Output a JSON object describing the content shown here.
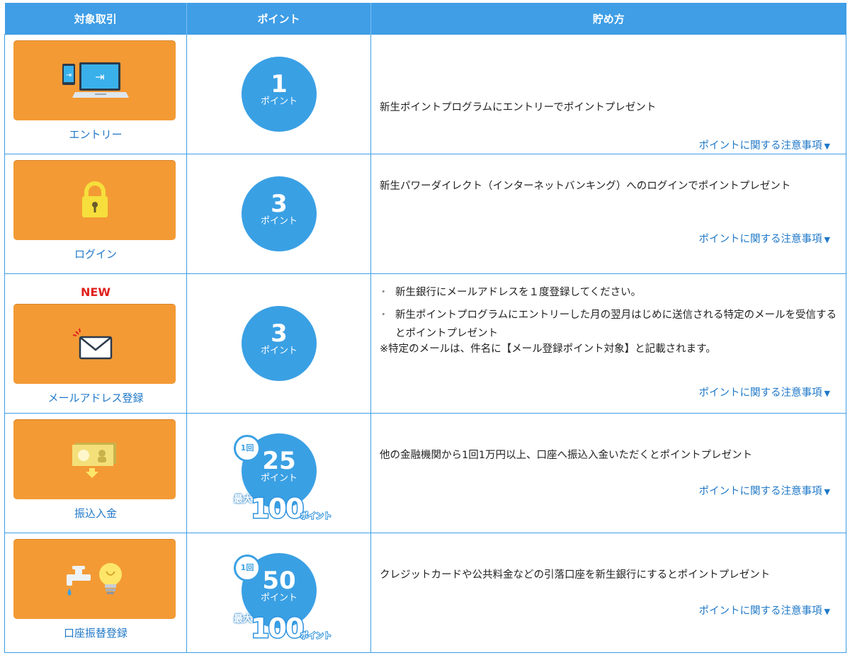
{
  "header": {
    "col1": "対象取引",
    "col2": "ポイント",
    "col3": "貯め方"
  },
  "rows": [
    {
      "label": "エントリー",
      "icon": "entry-devices-icon",
      "point": "1",
      "unit": "ポイント",
      "desc": "新生ポイントプログラムにエントリーでポイントプレゼント",
      "note": "ポイントに関する注意事項"
    },
    {
      "label": "ログイン",
      "icon": "padlock-icon",
      "point": "3",
      "unit": "ポイント",
      "desc": "新生パワーダイレクト（インターネットバンキング）へのログインでポイントプレゼント",
      "note": "ポイントに関する注意事項"
    },
    {
      "badge": "NEW",
      "label": "メールアドレス登録",
      "icon": "envelope-icon",
      "point": "3",
      "unit": "ポイント",
      "bullets": [
        "新生銀行にメールアドレスを１度登録してください。",
        "新生ポイントプログラムにエントリーした月の翌月はじめに送信される特定のメールを受信するとポイントプレゼント"
      ],
      "remark": "※特定のメールは、件名に【メール登録ポイント対象】と記載されます。",
      "note": "ポイントに関する注意事項"
    },
    {
      "label": "振込入金",
      "icon": "money-deposit-icon",
      "per": "1回",
      "point": "25",
      "unit": "ポイント",
      "max_label": "最大",
      "max": "100",
      "max_unit": "ポイント",
      "desc": "他の金融機関から1回1万円以上、口座へ振込入金いただくとポイントプレゼント",
      "note": "ポイントに関する注意事項"
    },
    {
      "label": "口座振替登録",
      "icon": "faucet-bulb-icon",
      "per": "1回",
      "point": "50",
      "unit": "ポイント",
      "max_label": "最大",
      "max": "100",
      "max_unit": "ポイント",
      "desc": "クレジットカードや公共料金などの引落口座を新生銀行にするとポイントプレゼント",
      "note": "ポイントに関する注意事項"
    }
  ],
  "colors": {
    "header_bg": "#3f9ee6",
    "card": "#f39a35",
    "circle": "#3aa0e4",
    "link": "#1f78c8",
    "new": "#e0211d"
  }
}
